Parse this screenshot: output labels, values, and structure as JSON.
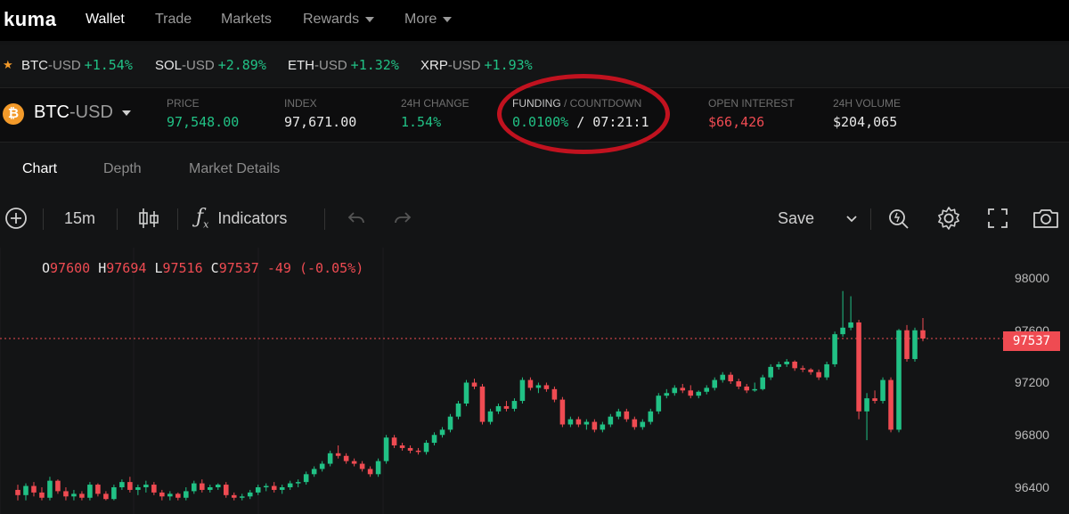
{
  "app": {
    "logo": "kuma"
  },
  "nav": [
    {
      "label": "Wallet",
      "active": true
    },
    {
      "label": "Trade"
    },
    {
      "label": "Markets"
    },
    {
      "label": "Rewards",
      "dropdown": true
    },
    {
      "label": "More",
      "dropdown": true
    }
  ],
  "ticker": [
    {
      "symbol": "BTC",
      "quote": "-USD",
      "change": "+1.54%"
    },
    {
      "symbol": "SOL",
      "quote": "-USD",
      "change": "+2.89%"
    },
    {
      "symbol": "ETH",
      "quote": "-USD",
      "change": "+1.32%"
    },
    {
      "symbol": "XRP",
      "quote": "-USD",
      "change": "+1.93%"
    }
  ],
  "market": {
    "coin_glyph": "₿",
    "pair_base": "BTC",
    "pair_quote": "-USD",
    "price_label": "PRICE",
    "price": "97,548.00",
    "index_label": "INDEX",
    "index": "97,671.00",
    "change_label": "24H CHANGE",
    "change": "1.54%",
    "funding_label": "FUNDING",
    "countdown_label": " / COUNTDOWN",
    "funding": "0.0100%",
    "countdown": " / 07:21:1",
    "oi_label": "OPEN INTEREST",
    "oi": "$66,426",
    "volume_label": "24H VOLUME",
    "volume": "$204,065"
  },
  "tabs": [
    {
      "label": "Chart",
      "active": true
    },
    {
      "label": "Depth"
    },
    {
      "label": "Market Details"
    }
  ],
  "toolbar": {
    "interval": "15m",
    "indicators_label": "Indicators",
    "save_label": "Save"
  },
  "ohlc": {
    "o_key": "O",
    "o": "97600",
    "h_key": "H",
    "h": "97694",
    "l_key": "L",
    "l": "97516",
    "c_key": "C",
    "c": "97537",
    "chg": "-49 (-0.05%)"
  },
  "chart_data": {
    "type": "candlestick",
    "y_axis_labels": [
      "98000",
      "97600",
      "97200",
      "96800",
      "96400"
    ],
    "ylim": [
      96300,
      98100
    ],
    "last_price": "97537",
    "candles": [
      {
        "o": 96380,
        "h": 96420,
        "l": 96300,
        "c": 96340
      },
      {
        "o": 96340,
        "h": 96430,
        "l": 96300,
        "c": 96410
      },
      {
        "o": 96410,
        "h": 96440,
        "l": 96330,
        "c": 96360
      },
      {
        "o": 96360,
        "h": 96400,
        "l": 96300,
        "c": 96320
      },
      {
        "o": 96320,
        "h": 96480,
        "l": 96300,
        "c": 96450
      },
      {
        "o": 96450,
        "h": 96460,
        "l": 96350,
        "c": 96370
      },
      {
        "o": 96370,
        "h": 96400,
        "l": 96300,
        "c": 96330
      },
      {
        "o": 96330,
        "h": 96380,
        "l": 96300,
        "c": 96350
      },
      {
        "o": 96350,
        "h": 96370,
        "l": 96300,
        "c": 96320
      },
      {
        "o": 96320,
        "h": 96440,
        "l": 96300,
        "c": 96420
      },
      {
        "o": 96420,
        "h": 96430,
        "l": 96330,
        "c": 96350
      },
      {
        "o": 96350,
        "h": 96370,
        "l": 96300,
        "c": 96310
      },
      {
        "o": 96310,
        "h": 96420,
        "l": 96300,
        "c": 96400
      },
      {
        "o": 96400,
        "h": 96460,
        "l": 96380,
        "c": 96440
      },
      {
        "o": 96440,
        "h": 96480,
        "l": 96360,
        "c": 96380
      },
      {
        "o": 96380,
        "h": 96420,
        "l": 96340,
        "c": 96400
      },
      {
        "o": 96400,
        "h": 96450,
        "l": 96360,
        "c": 96420
      },
      {
        "o": 96420,
        "h": 96440,
        "l": 96340,
        "c": 96360
      },
      {
        "o": 96360,
        "h": 96380,
        "l": 96300,
        "c": 96330
      },
      {
        "o": 96330,
        "h": 96370,
        "l": 96300,
        "c": 96350
      },
      {
        "o": 96350,
        "h": 96360,
        "l": 96300,
        "c": 96320
      },
      {
        "o": 96320,
        "h": 96400,
        "l": 96300,
        "c": 96370
      },
      {
        "o": 96370,
        "h": 96450,
        "l": 96350,
        "c": 96430
      },
      {
        "o": 96430,
        "h": 96460,
        "l": 96360,
        "c": 96380
      },
      {
        "o": 96380,
        "h": 96420,
        "l": 96360,
        "c": 96400
      },
      {
        "o": 96400,
        "h": 96430,
        "l": 96380,
        "c": 96420
      },
      {
        "o": 96420,
        "h": 96440,
        "l": 96320,
        "c": 96340
      },
      {
        "o": 96340,
        "h": 96360,
        "l": 96300,
        "c": 96320
      },
      {
        "o": 96320,
        "h": 96350,
        "l": 96300,
        "c": 96330
      },
      {
        "o": 96330,
        "h": 96380,
        "l": 96310,
        "c": 96360
      },
      {
        "o": 96360,
        "h": 96420,
        "l": 96340,
        "c": 96400
      },
      {
        "o": 96400,
        "h": 96430,
        "l": 96370,
        "c": 96410
      },
      {
        "o": 96410,
        "h": 96440,
        "l": 96360,
        "c": 96380
      },
      {
        "o": 96380,
        "h": 96420,
        "l": 96350,
        "c": 96400
      },
      {
        "o": 96400,
        "h": 96450,
        "l": 96380,
        "c": 96430
      },
      {
        "o": 96430,
        "h": 96460,
        "l": 96400,
        "c": 96440
      },
      {
        "o": 96440,
        "h": 96520,
        "l": 96420,
        "c": 96500
      },
      {
        "o": 96500,
        "h": 96560,
        "l": 96480,
        "c": 96540
      },
      {
        "o": 96540,
        "h": 96600,
        "l": 96520,
        "c": 96580
      },
      {
        "o": 96580,
        "h": 96680,
        "l": 96560,
        "c": 96660
      },
      {
        "o": 96660,
        "h": 96720,
        "l": 96620,
        "c": 96640
      },
      {
        "o": 96640,
        "h": 96660,
        "l": 96580,
        "c": 96600
      },
      {
        "o": 96600,
        "h": 96620,
        "l": 96560,
        "c": 96580
      },
      {
        "o": 96580,
        "h": 96600,
        "l": 96520,
        "c": 96540
      },
      {
        "o": 96540,
        "h": 96560,
        "l": 96480,
        "c": 96500
      },
      {
        "o": 96500,
        "h": 96620,
        "l": 96480,
        "c": 96600
      },
      {
        "o": 96600,
        "h": 96800,
        "l": 96580,
        "c": 96780
      },
      {
        "o": 96780,
        "h": 96800,
        "l": 96700,
        "c": 96720
      },
      {
        "o": 96720,
        "h": 96740,
        "l": 96680,
        "c": 96700
      },
      {
        "o": 96700,
        "h": 96720,
        "l": 96660,
        "c": 96680
      },
      {
        "o": 96680,
        "h": 96700,
        "l": 96650,
        "c": 96670
      },
      {
        "o": 96670,
        "h": 96760,
        "l": 96650,
        "c": 96740
      },
      {
        "o": 96740,
        "h": 96820,
        "l": 96720,
        "c": 96800
      },
      {
        "o": 96800,
        "h": 96860,
        "l": 96780,
        "c": 96840
      },
      {
        "o": 96840,
        "h": 96960,
        "l": 96820,
        "c": 96940
      },
      {
        "o": 96940,
        "h": 97060,
        "l": 96920,
        "c": 97040
      },
      {
        "o": 97040,
        "h": 97220,
        "l": 97020,
        "c": 97200
      },
      {
        "o": 97200,
        "h": 97230,
        "l": 97150,
        "c": 97170
      },
      {
        "o": 97170,
        "h": 97190,
        "l": 96880,
        "c": 96900
      },
      {
        "o": 96900,
        "h": 97000,
        "l": 96880,
        "c": 96980
      },
      {
        "o": 96980,
        "h": 97040,
        "l": 96960,
        "c": 97020
      },
      {
        "o": 97020,
        "h": 97060,
        "l": 96980,
        "c": 97000
      },
      {
        "o": 97000,
        "h": 97080,
        "l": 96980,
        "c": 97060
      },
      {
        "o": 97060,
        "h": 97240,
        "l": 97040,
        "c": 97220
      },
      {
        "o": 97220,
        "h": 97240,
        "l": 97140,
        "c": 97160
      },
      {
        "o": 97160,
        "h": 97200,
        "l": 97120,
        "c": 97180
      },
      {
        "o": 97180,
        "h": 97200,
        "l": 97130,
        "c": 97150
      },
      {
        "o": 97150,
        "h": 97170,
        "l": 97050,
        "c": 97070
      },
      {
        "o": 97070,
        "h": 97090,
        "l": 96860,
        "c": 96880
      },
      {
        "o": 96880,
        "h": 96940,
        "l": 96860,
        "c": 96920
      },
      {
        "o": 96920,
        "h": 96940,
        "l": 96860,
        "c": 96880
      },
      {
        "o": 96880,
        "h": 96920,
        "l": 96840,
        "c": 96900
      },
      {
        "o": 96900,
        "h": 96920,
        "l": 96820,
        "c": 96840
      },
      {
        "o": 96840,
        "h": 96900,
        "l": 96820,
        "c": 96880
      },
      {
        "o": 96880,
        "h": 96960,
        "l": 96860,
        "c": 96940
      },
      {
        "o": 96940,
        "h": 97000,
        "l": 96920,
        "c": 96980
      },
      {
        "o": 96980,
        "h": 97000,
        "l": 96900,
        "c": 96920
      },
      {
        "o": 96920,
        "h": 96940,
        "l": 96840,
        "c": 96860
      },
      {
        "o": 96860,
        "h": 96920,
        "l": 96840,
        "c": 96900
      },
      {
        "o": 96900,
        "h": 97000,
        "l": 96880,
        "c": 96980
      },
      {
        "o": 96980,
        "h": 97120,
        "l": 96960,
        "c": 97100
      },
      {
        "o": 97100,
        "h": 97150,
        "l": 97080,
        "c": 97120
      },
      {
        "o": 97120,
        "h": 97180,
        "l": 97100,
        "c": 97160
      },
      {
        "o": 97160,
        "h": 97190,
        "l": 97120,
        "c": 97140
      },
      {
        "o": 97140,
        "h": 97180,
        "l": 97080,
        "c": 97100
      },
      {
        "o": 97100,
        "h": 97140,
        "l": 97080,
        "c": 97130
      },
      {
        "o": 97130,
        "h": 97180,
        "l": 97110,
        "c": 97160
      },
      {
        "o": 97160,
        "h": 97240,
        "l": 97140,
        "c": 97220
      },
      {
        "o": 97220,
        "h": 97280,
        "l": 97200,
        "c": 97260
      },
      {
        "o": 97260,
        "h": 97280,
        "l": 97190,
        "c": 97210
      },
      {
        "o": 97210,
        "h": 97230,
        "l": 97150,
        "c": 97170
      },
      {
        "o": 97170,
        "h": 97190,
        "l": 97120,
        "c": 97140
      },
      {
        "o": 97140,
        "h": 97200,
        "l": 97130,
        "c": 97150
      },
      {
        "o": 97150,
        "h": 97260,
        "l": 97140,
        "c": 97240
      },
      {
        "o": 97240,
        "h": 97340,
        "l": 97220,
        "c": 97320
      },
      {
        "o": 97320,
        "h": 97360,
        "l": 97300,
        "c": 97340
      },
      {
        "o": 97340,
        "h": 97380,
        "l": 97320,
        "c": 97360
      },
      {
        "o": 97360,
        "h": 97370,
        "l": 97290,
        "c": 97310
      },
      {
        "o": 97310,
        "h": 97330,
        "l": 97280,
        "c": 97300
      },
      {
        "o": 97300,
        "h": 97310,
        "l": 97260,
        "c": 97280
      },
      {
        "o": 97280,
        "h": 97300,
        "l": 97220,
        "c": 97240
      },
      {
        "o": 97240,
        "h": 97360,
        "l": 97220,
        "c": 97340
      },
      {
        "o": 97340,
        "h": 97590,
        "l": 97320,
        "c": 97570
      },
      {
        "o": 97570,
        "h": 97900,
        "l": 97550,
        "c": 97620
      },
      {
        "o": 97620,
        "h": 97860,
        "l": 97600,
        "c": 97660
      },
      {
        "o": 97660,
        "h": 97680,
        "l": 96920,
        "c": 96980
      },
      {
        "o": 96980,
        "h": 97120,
        "l": 96760,
        "c": 97080
      },
      {
        "o": 97080,
        "h": 97140,
        "l": 97040,
        "c": 97060
      },
      {
        "o": 97060,
        "h": 97240,
        "l": 97040,
        "c": 97220
      },
      {
        "o": 97220,
        "h": 97240,
        "l": 96820,
        "c": 96840
      },
      {
        "o": 96840,
        "h": 97610,
        "l": 96820,
        "c": 97600
      },
      {
        "o": 97600,
        "h": 97640,
        "l": 97360,
        "c": 97380
      },
      {
        "o": 97380,
        "h": 97620,
        "l": 97360,
        "c": 97600
      },
      {
        "o": 97600,
        "h": 97694,
        "l": 97516,
        "c": 97537
      }
    ]
  }
}
